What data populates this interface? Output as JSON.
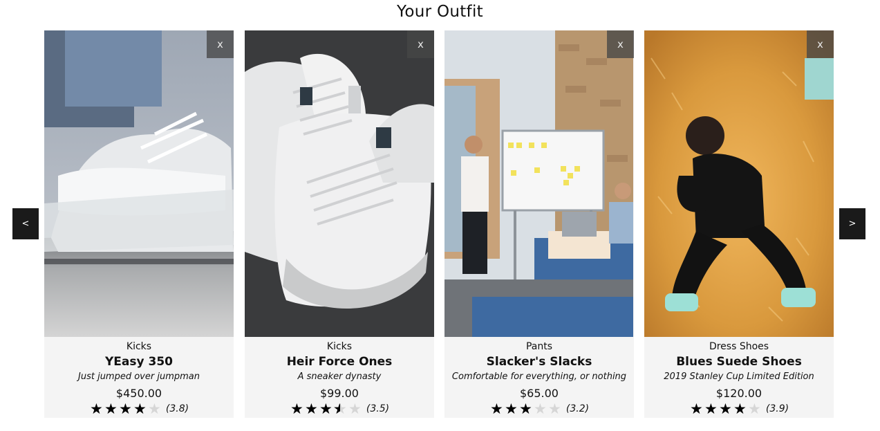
{
  "header": {
    "title": "Your Outfit"
  },
  "carousel": {
    "prev_label": "<",
    "next_label": ">"
  },
  "cards": [
    {
      "category": "Kicks",
      "name": "YEasy 350",
      "description": "Just jumped over jumpman",
      "price": "$450.00",
      "rating": 3.8,
      "rating_text": "(3.8)",
      "remove_label": "x",
      "image": "white-knit-sneaker-on-foot-photo"
    },
    {
      "category": "Kicks",
      "name": "Heir Force Ones",
      "description": "A sneaker dynasty",
      "price": "$99.00",
      "rating": 3.5,
      "rating_text": "(3.5)",
      "remove_label": "x",
      "image": "white-leather-sneakers-photo"
    },
    {
      "category": "Pants",
      "name": "Slacker's Slacks",
      "description": "Comfortable for everything, or nothing",
      "price": "$65.00",
      "rating": 3.2,
      "rating_text": "(3.2)",
      "remove_label": "x",
      "image": "office-whiteboard-meeting-photo"
    },
    {
      "category": "Dress Shoes",
      "name": "Blues Suede Shoes",
      "description": "2019 Stanley Cup Limited Edition",
      "price": "$120.00",
      "rating": 3.9,
      "rating_text": "(3.9)",
      "remove_label": "x",
      "image": "man-on-fur-beanbag-photo"
    }
  ],
  "colors": {
    "card_bg": "#f4f4f4",
    "nav_bg": "#1a1a1a",
    "star_filled": "#000000",
    "star_empty": "#d6d6d6"
  },
  "icons": {
    "star": "star-icon",
    "remove": "close-icon",
    "prev": "chevron-left-icon",
    "next": "chevron-right-icon"
  }
}
